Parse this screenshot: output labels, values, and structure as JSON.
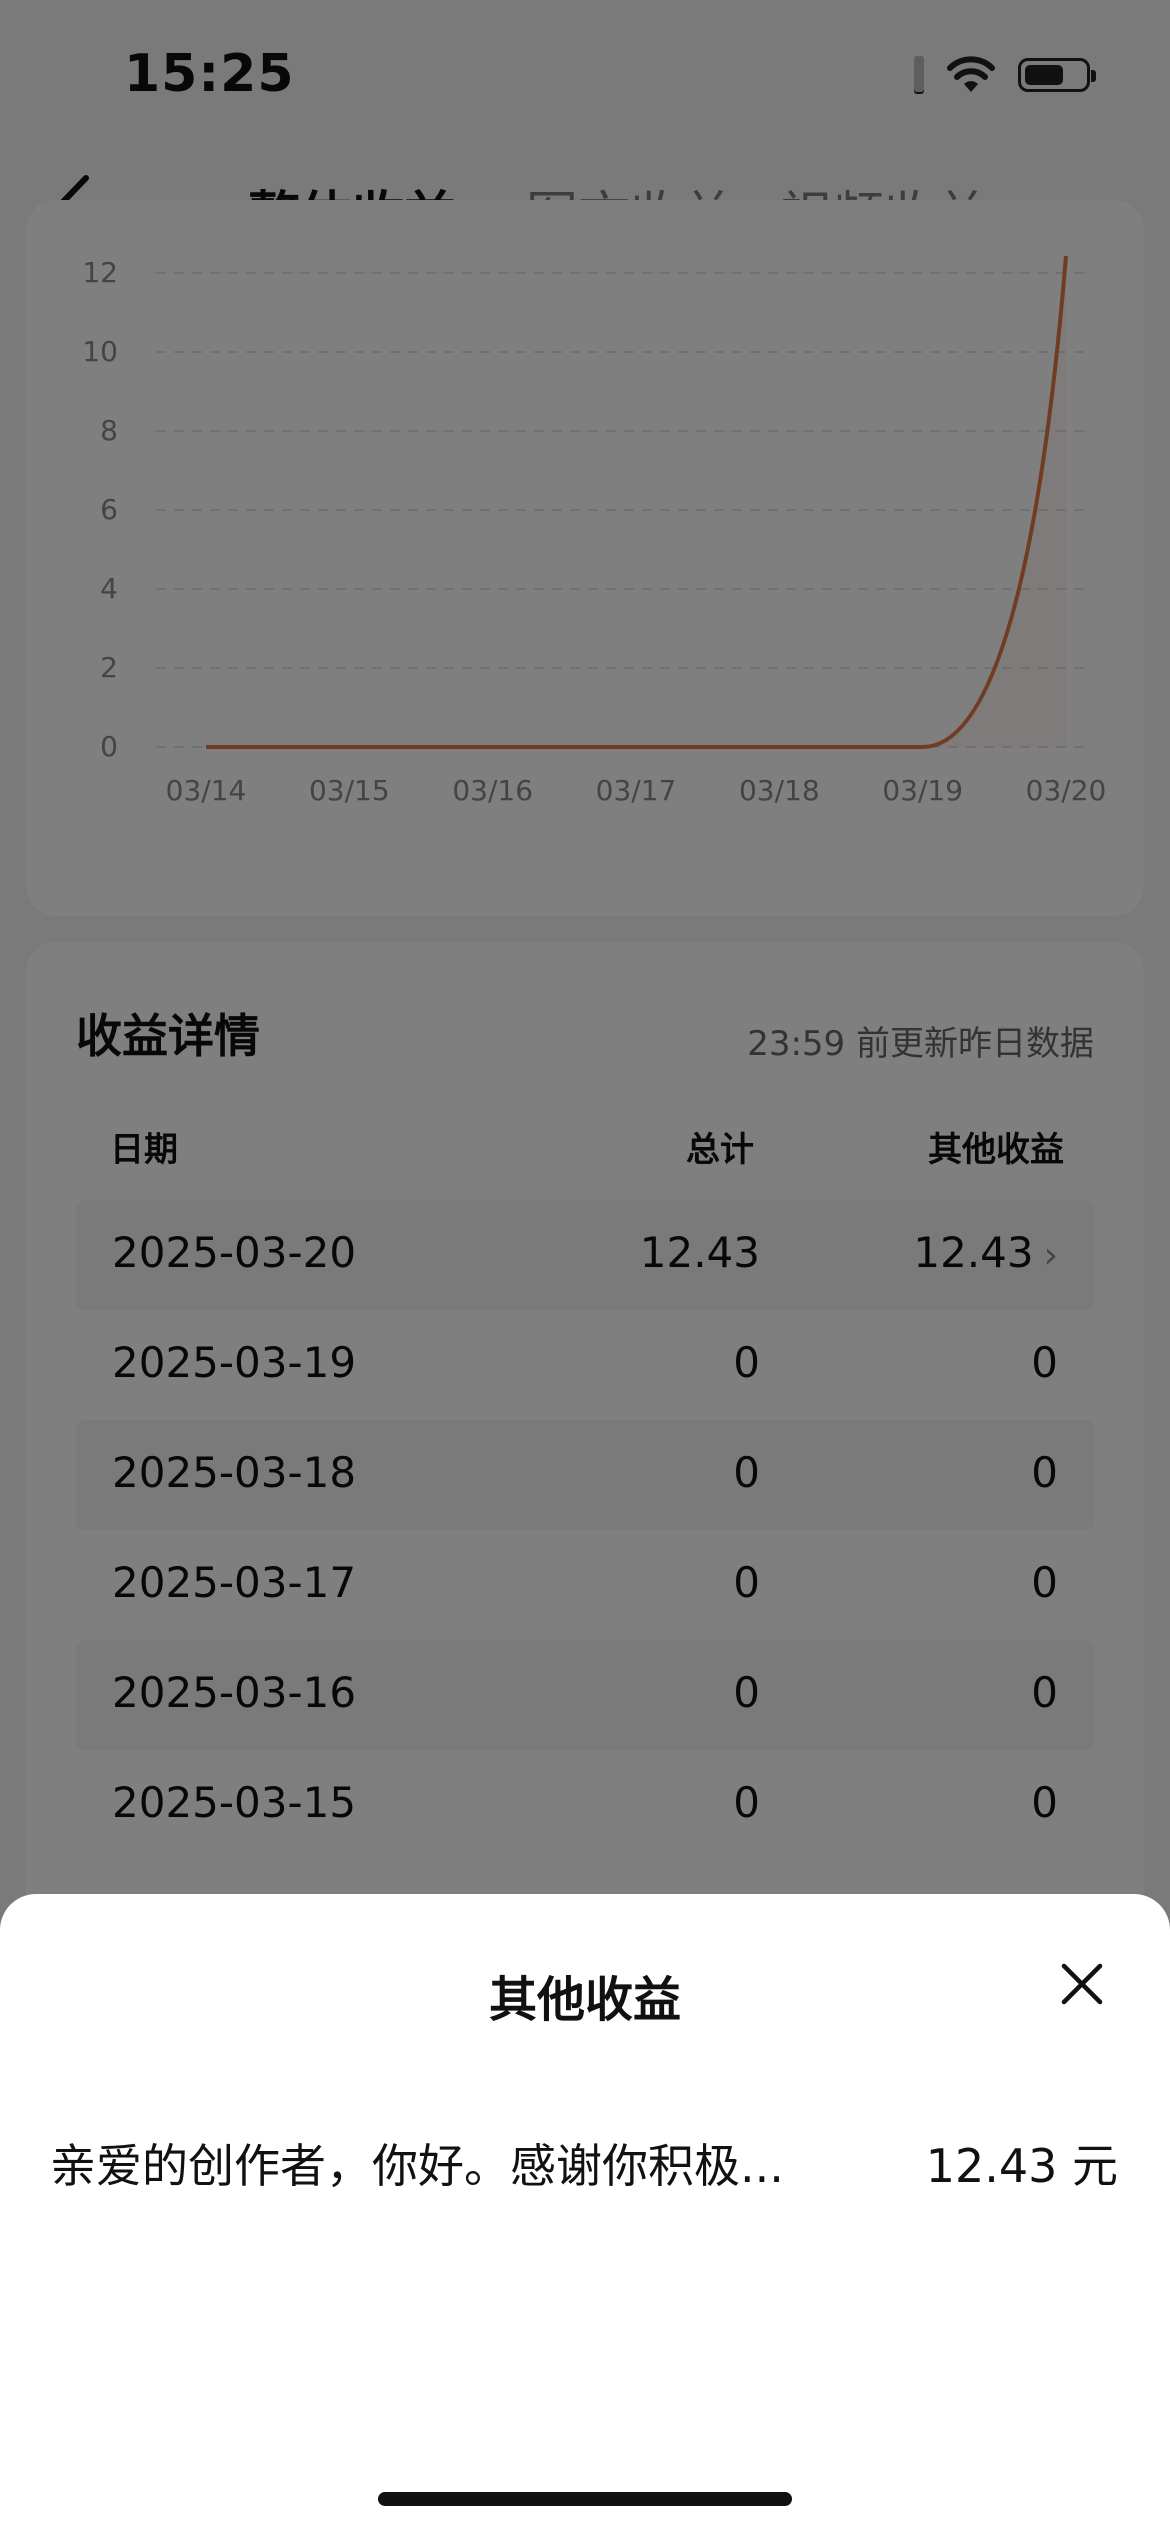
{
  "status": {
    "time": "15:25"
  },
  "nav": {
    "tabs": [
      "整体收益",
      "图文收益",
      "视频收益"
    ],
    "active_index": 0
  },
  "chart_data": {
    "type": "line",
    "x": [
      "03/14",
      "03/15",
      "03/16",
      "03/17",
      "03/18",
      "03/19",
      "03/20"
    ],
    "series": [
      {
        "values": [
          0,
          0,
          0,
          0,
          0,
          0,
          12.43
        ]
      }
    ],
    "yticks": [
      "0",
      "2",
      "4",
      "6",
      "8",
      "10",
      "12"
    ],
    "ylim": [
      0,
      12
    ],
    "grid": true,
    "line_color": "#e07a45"
  },
  "details": {
    "title": "收益详情",
    "note": "23:59 前更新昨日数据",
    "headers": {
      "date": "日期",
      "total": "总计",
      "other": "其他收益"
    },
    "rows": [
      {
        "date": "2025-03-20",
        "total": "12.43",
        "other": "12.43"
      },
      {
        "date": "2025-03-19",
        "total": "0",
        "other": "0"
      },
      {
        "date": "2025-03-18",
        "total": "0",
        "other": "0"
      },
      {
        "date": "2025-03-17",
        "total": "0",
        "other": "0"
      },
      {
        "date": "2025-03-16",
        "total": "0",
        "other": "0"
      },
      {
        "date": "2025-03-15",
        "total": "0",
        "other": "0"
      }
    ]
  },
  "sheet": {
    "title": "其他收益",
    "item_text": "亲爱的创作者，你好。感谢你积极...",
    "item_amount": "12.43 元"
  }
}
